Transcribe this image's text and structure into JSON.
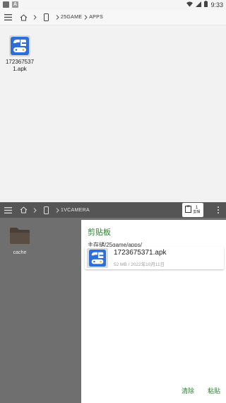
{
  "status_bar": {
    "time": "9:33",
    "left_badge_1": "",
    "left_badge_2": "A"
  },
  "top_pane": {
    "breadcrumb": [
      "25GAME",
      "APPS"
    ],
    "files": [
      {
        "name": "1723675371.apk",
        "icon": "apk-game-icon"
      }
    ]
  },
  "bottom_pane": {
    "breadcrumb": [
      "1VCAMERA"
    ],
    "clipboard_button": {
      "count": "1",
      "label": "剪辑"
    },
    "folders": [
      {
        "name": "cache"
      }
    ]
  },
  "clipboard_panel": {
    "title": "剪贴板",
    "path": "主存储/25game/apps/",
    "items": [
      {
        "name": "1723675371.apk",
        "meta": "52 MB / 2022年10月11日"
      }
    ],
    "clear_label": "清除",
    "paste_label": "粘贴"
  },
  "colors": {
    "accent": "#2e7d32",
    "pane_dim": "#6f6f6f"
  }
}
